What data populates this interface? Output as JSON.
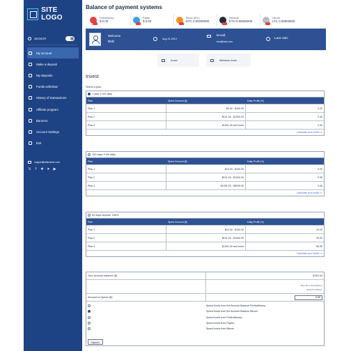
{
  "sidebar": {
    "logo_text": "SITE LOGO",
    "time": "15:04:07",
    "nav": [
      {
        "label": "My account",
        "active": true
      },
      {
        "label": "Make a deposit"
      },
      {
        "label": "My deposits"
      },
      {
        "label": "Funds withdraw"
      },
      {
        "label": "History of transactions"
      },
      {
        "label": "Affiliate program"
      },
      {
        "label": "Banners"
      },
      {
        "label": "Account Settings"
      },
      {
        "label": "Exit"
      }
    ],
    "email": "support@sitename.com",
    "social_icons": [
      "twitter-icon",
      "facebook-icon",
      "vk-icon",
      "telegram-icon",
      "youtube-icon"
    ]
  },
  "header": {
    "title": "Balance of payment systems",
    "wallets": [
      {
        "name": "PerfectMoney",
        "value": "$ 0.00",
        "icon": "perfectmoney-icon",
        "color": "#e44242"
      },
      {
        "name": "Payeer",
        "value": "$ 0.00",
        "icon": "payeer-icon",
        "color": "#3aa0e8"
      },
      {
        "name": "Bitcoin (BTC)",
        "value": "BTC 0.00000000",
        "icon": "bitcoin-icon",
        "color": "#f7931a"
      },
      {
        "name": "Ethereum",
        "value": "ETH 0.00000000",
        "icon": "ethereum-icon",
        "color": "#222a3a"
      },
      {
        "name": "Litecoin",
        "value": "LTC 0.00000000",
        "icon": "litecoin-icon",
        "color": "#b7bcc6"
      }
    ]
  },
  "welcome": {
    "label": "Welcome",
    "username": "test",
    "date": "Aug-31-2019",
    "email_label": "Email:",
    "email": "test@test.com",
    "last_visit_label": "Last visit:"
  },
  "hero_buttons": {
    "invest": "Invest",
    "withdraw": "Withdraw funds"
  },
  "invest": {
    "title": "Invest",
    "select_label": "Select a plan:",
    "columns": [
      "Plan",
      "Spent Amount ($)",
      "Daily Profit (%)"
    ],
    "calc_link": "Calculate your profit >>",
    "plans": [
      {
        "name": "1 year 2.4% daily",
        "selected": true,
        "rows": [
          [
            "Plan 1",
            "$0.00 - $100.00",
            "2.20"
          ],
          [
            "Plan 2",
            "$101.00 - $1000.00",
            "2.30"
          ],
          [
            "Plan 3",
            "$1001.00 and more",
            "2.40"
          ]
        ]
      },
      {
        "name": "100 days 3.4% daily",
        "selected": false,
        "rows": [
          [
            "Plan 1",
            "$10.00 - $100.00",
            "3.20"
          ],
          [
            "Plan 2",
            "$101.00 - $1000.00",
            "3.30"
          ],
          [
            "Plan 3",
            "$1001.00 - $5000.00",
            "3.40"
          ]
        ]
      },
      {
        "name": "30 days deposit. 150%",
        "selected": false,
        "rows": [
          [
            "Plan 1",
            "$10.00 - $100.00",
            "10.00"
          ],
          [
            "Plan 2",
            "$101.00 - $1000.00",
            "30.00"
          ],
          [
            "Plan 3",
            "$1001.00 and more",
            "50.00"
          ]
        ]
      }
    ]
  },
  "deposit": {
    "balance_label": "Your account balance ($):",
    "balance_value": "$760.34",
    "balance_note_1": "$911.26 of PerfectMoney",
    "balance_note_2": "$209.04 of Bitcoin",
    "amount_label": "Amount to Spend ($):",
    "amount_value": "0.00",
    "options": [
      "Spend funds from the Account Balance PerfectMoney",
      "Spend funds from the Account Balance Bitcoin",
      "Spend funds from PerfectMoney",
      "Spend funds from Payeer",
      "Spend funds from Bitcoin"
    ],
    "selected_option": 1,
    "spend_button": "Spend"
  }
}
